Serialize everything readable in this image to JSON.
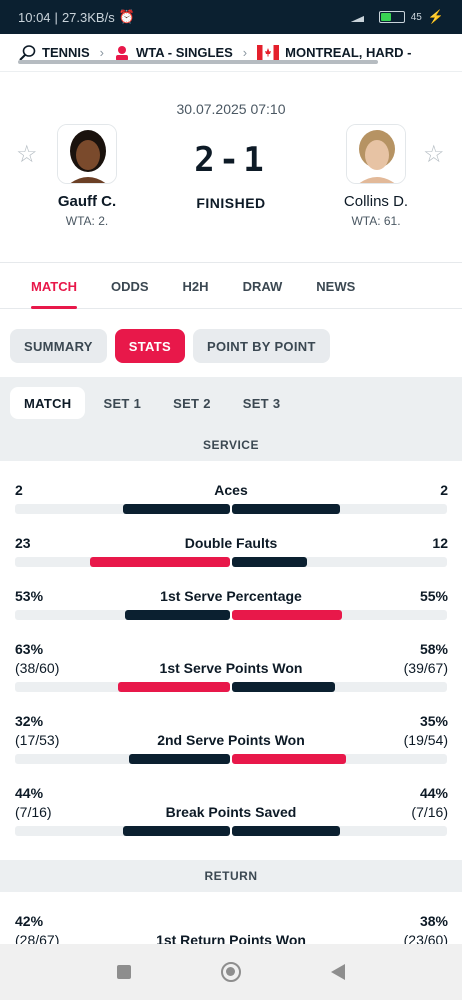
{
  "status_bar": {
    "time": "10:04",
    "speed": "27.3KB/s",
    "battery": "45"
  },
  "breadcrumb": {
    "sport": "TENNIS",
    "category": "WTA - SINGLES",
    "tournament": "MONTREAL, HARD - "
  },
  "match": {
    "date": "30.07.2025 07:10",
    "score": "2-1",
    "status": "FINISHED",
    "home": {
      "name": "Gauff C.",
      "rank": "WTA: 2."
    },
    "away": {
      "name": "Collins D.",
      "rank": "WTA: 61."
    }
  },
  "tabs": [
    "MATCH",
    "ODDS",
    "H2H",
    "DRAW",
    "NEWS"
  ],
  "subtabs": [
    "SUMMARY",
    "STATS",
    "POINT BY POINT"
  ],
  "set_tabs": [
    "MATCH",
    "SET 1",
    "SET 2",
    "SET 3"
  ],
  "sections": {
    "service": "SERVICE",
    "return": "RETURN"
  },
  "colors": {
    "accent": "#e8184a",
    "dark_bar": "#0b2030",
    "track": "#eceff1"
  },
  "stats": [
    {
      "name": "Aces",
      "home": "2",
      "away": "2",
      "home_sub": "",
      "away_sub": "",
      "home_frac": 0.5,
      "away_frac": 0.5,
      "home_hl": false,
      "away_hl": false
    },
    {
      "name": "Double Faults",
      "home": "23",
      "away": "12",
      "home_sub": "",
      "away_sub": "",
      "home_frac": 0.65,
      "away_frac": 0.35,
      "home_hl": true,
      "away_hl": false
    },
    {
      "name": "1st Serve Percentage",
      "home": "53%",
      "away": "55%",
      "home_sub": "",
      "away_sub": "",
      "home_frac": 0.49,
      "away_frac": 0.51,
      "home_hl": false,
      "away_hl": true
    },
    {
      "name": "1st Serve Points Won",
      "home": "63%",
      "away": "58%",
      "home_sub": "(38/60)",
      "away_sub": "(39/67)",
      "home_frac": 0.52,
      "away_frac": 0.48,
      "home_hl": true,
      "away_hl": false
    },
    {
      "name": "2nd Serve Points Won",
      "home": "32%",
      "away": "35%",
      "home_sub": "(17/53)",
      "away_sub": "(19/54)",
      "home_frac": 0.47,
      "away_frac": 0.53,
      "home_hl": false,
      "away_hl": true
    },
    {
      "name": "Break Points Saved",
      "home": "44%",
      "away": "44%",
      "home_sub": "(7/16)",
      "away_sub": "(7/16)",
      "home_frac": 0.5,
      "away_frac": 0.5,
      "home_hl": false,
      "away_hl": false
    },
    {
      "name": "1st Return Points Won",
      "home": "42%",
      "away": "38%",
      "home_sub": "(28/67)",
      "away_sub": "(23/60)",
      "home_frac": 0.52,
      "away_frac": 0.48,
      "home_hl": true,
      "away_hl": false
    }
  ]
}
